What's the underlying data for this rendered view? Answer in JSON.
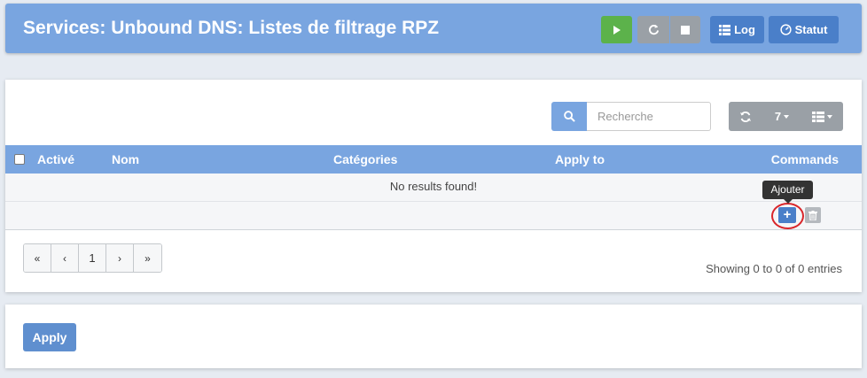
{
  "header": {
    "title": "Services: Unbound DNS: Listes de filtrage RPZ",
    "log_label": "Log",
    "status_label": "Statut"
  },
  "toolbar": {
    "search_placeholder": "Recherche",
    "row_count": "7"
  },
  "table": {
    "columns": [
      "Activé",
      "Nom",
      "Catégories",
      "Apply to",
      "Commands"
    ],
    "empty_text": "No results found!",
    "add_tooltip": "Ajouter"
  },
  "pagination": {
    "first": "«",
    "prev": "‹",
    "page": "1",
    "next": "›",
    "last": "»",
    "info": "Showing 0 to 0 of 0 entries"
  },
  "footer": {
    "apply_label": "Apply"
  },
  "colors": {
    "header_bg": "#79a5e0",
    "primary": "#4a7fc9",
    "success": "#5cb24b",
    "default": "#9aa0a6",
    "highlight_ring": "#d9262b"
  }
}
